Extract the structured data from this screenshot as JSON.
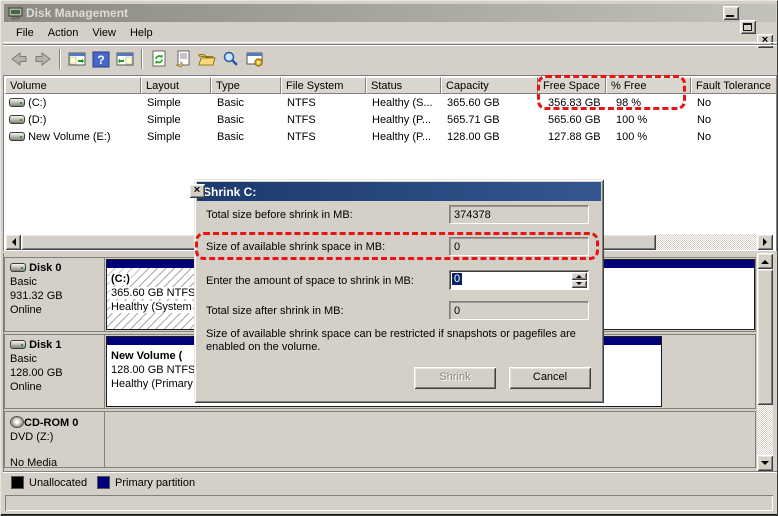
{
  "window": {
    "title": "Disk Management",
    "controls": [
      "minimize",
      "maximize",
      "close"
    ]
  },
  "menu_bar": {
    "items": [
      "File",
      "Action",
      "View",
      "Help"
    ]
  },
  "toolbar": {
    "icons": [
      "back",
      "forward",
      "show-console-tree",
      "help",
      "show-action-pane",
      "refresh",
      "properties",
      "open-folder",
      "find",
      "manage-computer"
    ]
  },
  "volume_table": {
    "columns": [
      "Volume",
      "Layout",
      "Type",
      "File System",
      "Status",
      "Capacity",
      "Free Space",
      "% Free",
      "Fault Tolerance"
    ],
    "rows": [
      [
        "(C:)",
        "Simple",
        "Basic",
        "NTFS",
        "Healthy (S...",
        "365.60 GB",
        "356.83 GB",
        "98 %",
        "No"
      ],
      [
        "(D:)",
        "Simple",
        "Basic",
        "NTFS",
        "Healthy (P...",
        "565.71 GB",
        "565.60 GB",
        "100 %",
        "No"
      ],
      [
        "New Volume (E:)",
        "Simple",
        "Basic",
        "NTFS",
        "Healthy (P...",
        "128.00 GB",
        "127.88 GB",
        "100 %",
        "No"
      ]
    ]
  },
  "graphical_view": {
    "disks": [
      {
        "name": "Disk 0",
        "kind": "Basic",
        "size": "931.32 GB",
        "status": "Online",
        "partitions": [
          {
            "label": "(C:)",
            "line2": "365.60 GB NTFS",
            "line3": "Healthy (System",
            "selected": true
          },
          {
            "label": "",
            "line2": "",
            "line3": "",
            "selected": false
          }
        ]
      },
      {
        "name": "Disk 1",
        "kind": "Basic",
        "size": "128.00 GB",
        "status": "Online",
        "partitions": [
          {
            "label": "New Volume (",
            "line2": "128.00 GB NTFS",
            "line3": "Healthy (Primary",
            "selected": false
          }
        ]
      },
      {
        "name": "CD-ROM 0",
        "kind": "DVD (Z:)",
        "size": "",
        "status": "No Media",
        "partitions": []
      }
    ]
  },
  "legend": {
    "items": [
      {
        "label": "Unallocated",
        "color": "#000000"
      },
      {
        "label": "Primary partition",
        "color": "#00007b"
      }
    ]
  },
  "dialog": {
    "title": "Shrink C:",
    "fields": [
      {
        "label": "Total size before shrink in MB:",
        "value": "374378"
      },
      {
        "label": "Size of available shrink space in MB:",
        "value": "0"
      },
      {
        "label": "Enter the amount of space to shrink in MB:",
        "value": "0"
      },
      {
        "label": "Total size after shrink in MB:",
        "value": "0"
      }
    ],
    "note": "Size of available shrink space can be restricted if snapshots or pagefiles are enabled on the volume.",
    "shrink_button": "Shrink",
    "shrink_enabled": false,
    "cancel_button": "Cancel"
  },
  "annotations": {
    "highlight_color": "#e81414"
  }
}
